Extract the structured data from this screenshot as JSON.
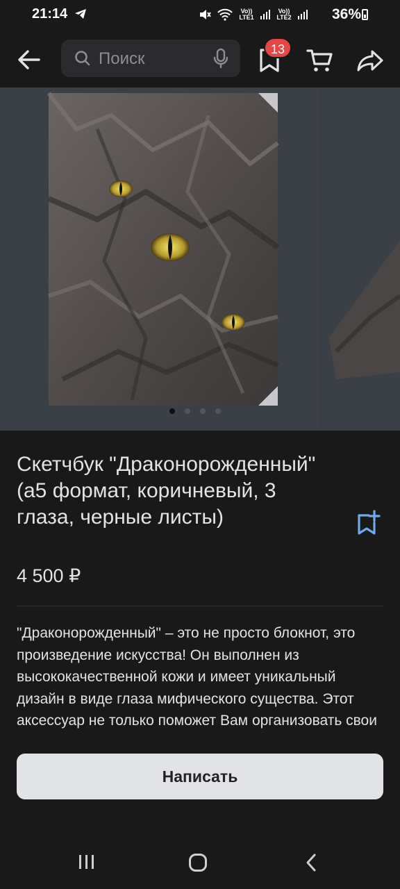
{
  "status_bar": {
    "time": "21:14",
    "battery": "36%",
    "sim1_label": "Vo)) LTE1",
    "sim2_label": "Vo)) LTE2",
    "icons": [
      "telegram-icon",
      "mute-icon",
      "wifi-icon",
      "signal-icon",
      "battery-icon"
    ]
  },
  "header": {
    "search_placeholder": "Поиск",
    "bookmarks_badge": "13",
    "icons": [
      "back-arrow-icon",
      "search-icon",
      "microphone-icon",
      "bookmark-icon",
      "cart-icon",
      "share-icon"
    ]
  },
  "gallery": {
    "total_photos": 4,
    "active_index": 0
  },
  "product": {
    "title": "Скетчбук \"Драконорожденный\" (а5 формат, коричневый, 3 глаза, черные листы)",
    "price": "4 500 ₽",
    "description": "\"Драконорожденный\" – это не просто блокнот, это произведение искусства! Он выполнен из высококачественной кожи и имеет уникальный дизайн в виде глаза мифического существа. Этот аксессуар не только поможет Вам организовать свои"
  },
  "actions": {
    "write_button": "Написать"
  },
  "colors": {
    "background": "#19191a",
    "text": "#e1e3e6",
    "accent": "#71aaeb",
    "badge": "#e64646"
  }
}
